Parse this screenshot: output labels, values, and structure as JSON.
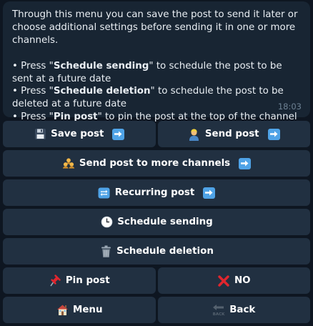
{
  "message": {
    "intro": "Through this menu you can save the post to send it later or choose additional settings before sending it in one or more channels.",
    "items": [
      {
        "bullet": "• Press \"",
        "key": "Schedule sending",
        "rest": "\" to schedule the post to be sent at a future date"
      },
      {
        "bullet": "• Press \"",
        "key": "Schedule deletion",
        "rest": "\" to schedule the post to be deleted at a future date"
      },
      {
        "bullet": "• Press \"",
        "key": "Pin post",
        "rest": "\" to pin the post at the top of the channel"
      }
    ],
    "time": "18:03"
  },
  "keyboard": {
    "save_post": "Save post",
    "send_post": "Send post",
    "send_more": "Send post to more channels",
    "recurring": "Recurring post",
    "schedule_sending": "Schedule sending",
    "schedule_deletion": "Schedule deletion",
    "pin_post": "Pin post",
    "no": "NO",
    "menu": "Menu",
    "back": "Back"
  },
  "colors": {
    "background": "#0e1621",
    "bubble": "#182533",
    "button": "#213041",
    "arrow_accent": "#4fa3e7",
    "cross_red": "#e0262e"
  },
  "icons": [
    "floppy-disk-icon",
    "arrow-right-icon",
    "person-icon",
    "group-icon",
    "repeat-icon",
    "clock-icon",
    "trash-icon",
    "pushpin-icon",
    "cross-mark-icon",
    "house-icon",
    "back-arrow-icon"
  ]
}
